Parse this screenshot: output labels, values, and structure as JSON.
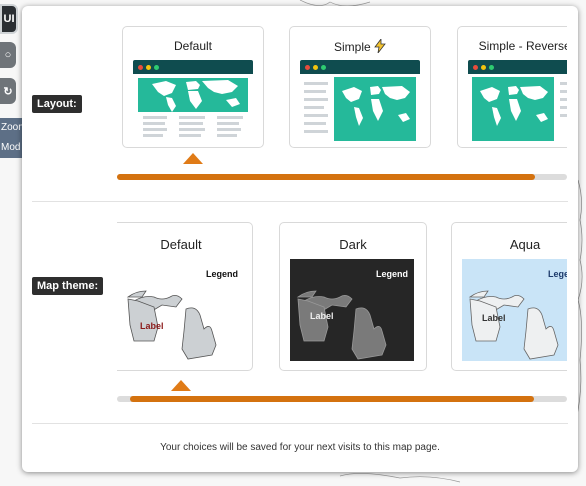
{
  "toolbar": {
    "ui_label": "UI",
    "zoom_label": "Zoom",
    "mode_label": "Mod"
  },
  "modal": {
    "layout_label": "Layout:",
    "theme_label": "Map theme:",
    "layout_options": [
      {
        "title": "Default"
      },
      {
        "title": "Simple"
      },
      {
        "title": "Simple - Reversed"
      }
    ],
    "theme_options": [
      {
        "title": "Default",
        "legend": "Legend",
        "label": "Label"
      },
      {
        "title": "Dark",
        "legend": "Legend",
        "label": "Label"
      },
      {
        "title": "Aqua",
        "legend": "Legend",
        "label": "Label"
      }
    ],
    "footer": "Your choices will be saved for your next visits to this map page."
  },
  "colors": {
    "accent": "#d4720f",
    "layout_header": "#0f4c4f",
    "layout_map": "#25b99a",
    "theme_dark_bg": "#262626",
    "theme_aqua_bg": "#c9e4f7"
  }
}
